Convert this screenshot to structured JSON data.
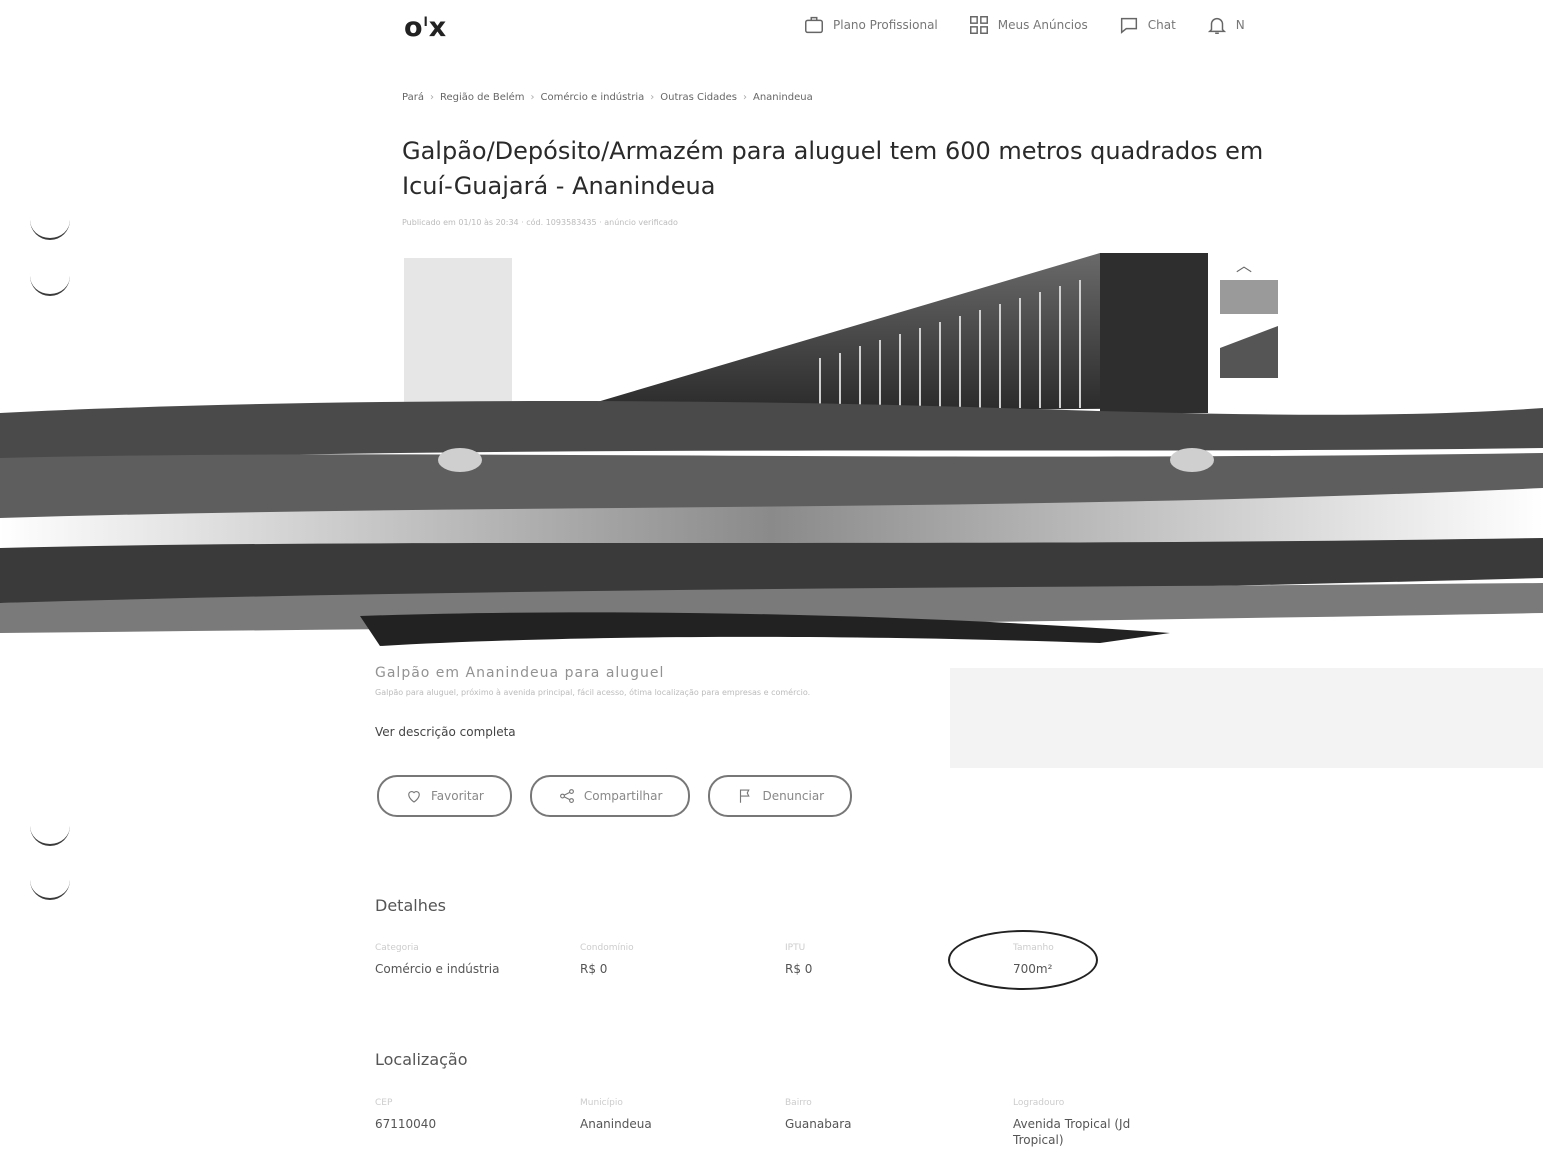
{
  "header": {
    "logo": "o",
    "logo_sup": "l",
    "logo_x": "x",
    "nav": [
      {
        "label": "Plano Profissional",
        "icon": "briefcase-icon"
      },
      {
        "label": "Meus Anúncios",
        "icon": "grid-icon"
      },
      {
        "label": "Chat",
        "icon": "chat-icon"
      },
      {
        "label": "N",
        "icon": "bell-icon"
      }
    ]
  },
  "breadcrumb": [
    "Pará",
    "Região de Belém",
    "Comércio e indústria",
    "Outras Cidades",
    "Ananindeua"
  ],
  "listing": {
    "title": "Galpão/Depósito/Armazém para aluguel tem 600 metros quadrados em Icuí-Guajará - Ananindeua",
    "meta": "Publicado em 01/10 às 20:34 · cód. 1093583435 · anúncio verificado",
    "description_ghost": "Galpão em Ananindeua para aluguel",
    "description_faint": "Galpão para aluguel, próximo à avenida principal, fácil acesso, ótima localização para empresas e comércio.",
    "see_more": "Ver descrição completa"
  },
  "actions": {
    "favorite": "Favoritar",
    "share": "Compartilhar",
    "report": "Denunciar"
  },
  "details": {
    "title": "Detalhes",
    "items": [
      {
        "label": "Categoria",
        "value": "Comércio e indústria"
      },
      {
        "label": "Condomínio",
        "value": "R$ 0"
      },
      {
        "label": "IPTU",
        "value": "R$ 0"
      },
      {
        "label": "Tamanho",
        "value": "700m²"
      }
    ]
  },
  "location": {
    "title": "Localização",
    "items": [
      {
        "label": "CEP",
        "value": "67110040"
      },
      {
        "label": "Município",
        "value": "Ananindeua"
      },
      {
        "label": "Bairro",
        "value": "Guanabara"
      },
      {
        "label": "Logradouro",
        "value": "Avenida Tropical (Jd Tropical)"
      }
    ]
  }
}
